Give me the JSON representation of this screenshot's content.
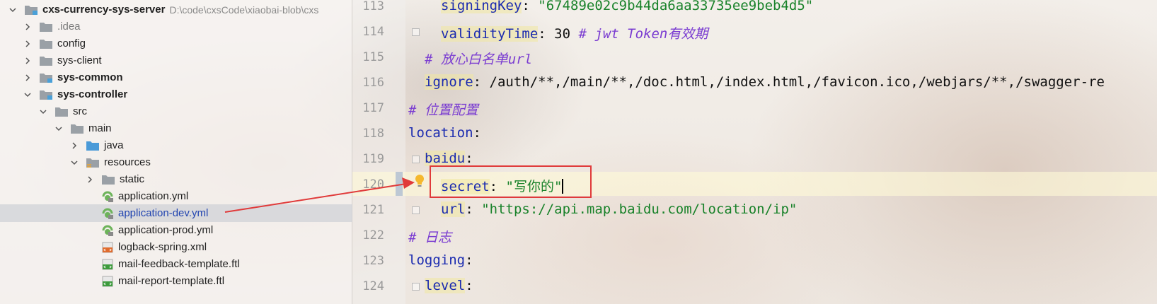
{
  "project": {
    "name": "cxs-currency-sys-server",
    "path": "D:\\code\\cxsCode\\xiaobai-blob\\cxs"
  },
  "tree": [
    {
      "label": ".idea",
      "type": "folder",
      "muted": true
    },
    {
      "label": "config",
      "type": "folder"
    },
    {
      "label": "sys-client",
      "type": "folder"
    },
    {
      "label": "sys-common",
      "type": "module",
      "bold": true
    },
    {
      "label": "sys-controller",
      "type": "module",
      "bold": true
    },
    {
      "label": "src",
      "type": "folder"
    },
    {
      "label": "main",
      "type": "folder"
    },
    {
      "label": "java",
      "type": "source-folder"
    },
    {
      "label": "resources",
      "type": "resource-folder"
    },
    {
      "label": "static",
      "type": "folder"
    },
    {
      "label": "application.yml",
      "type": "yml"
    },
    {
      "label": "application-dev.yml",
      "type": "yml",
      "selected": true
    },
    {
      "label": "application-prod.yml",
      "type": "yml"
    },
    {
      "label": "logback-spring.xml",
      "type": "xml"
    },
    {
      "label": "mail-feedback-template.ftl",
      "type": "ftl"
    },
    {
      "label": "mail-report-template.ftl",
      "type": "ftl"
    }
  ],
  "editor": {
    "lines": [
      {
        "no": "113",
        "key": "signingKey",
        "value": "\"67489e02c9b44da6aa33735ee9beb4d5\""
      },
      {
        "no": "114",
        "key": "validityTime",
        "value": "30",
        "comment": "# jwt Token有效期"
      },
      {
        "no": "115",
        "comment": "# 放心白名单url"
      },
      {
        "no": "116",
        "key": "ignore",
        "value": "/auth/**,/main/**,/doc.html,/index.html,/favicon.ico,/webjars/**,/swagger-re"
      },
      {
        "no": "117",
        "comment": "# 位置配置"
      },
      {
        "no": "118",
        "key": "location"
      },
      {
        "no": "119",
        "key": "baidu"
      },
      {
        "no": "120",
        "key": "secret",
        "value": "\"写你的\""
      },
      {
        "no": "121",
        "key": "url",
        "value": "\"https://api.map.baidu.com/location/ip\""
      },
      {
        "no": "122",
        "comment": "# 日志"
      },
      {
        "no": "123",
        "key": "logging"
      },
      {
        "no": "124",
        "key": "level"
      }
    ]
  },
  "colors": {
    "key": "#1b2bb0",
    "string": "#19822a",
    "comment": "#7a3cd1",
    "annotation": "#e03a3a"
  },
  "icons": {
    "bulb": "lightbulb-icon",
    "folder": "folder-icon",
    "yml": "yml-file-icon",
    "xml": "xml-file-icon",
    "ftl": "ftl-file-icon"
  }
}
